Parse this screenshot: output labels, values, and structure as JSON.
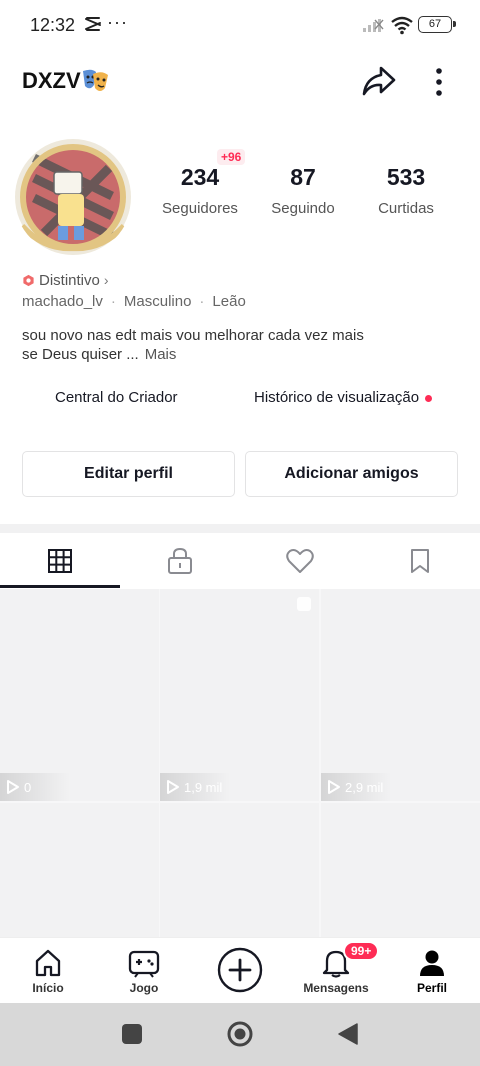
{
  "status_bar": {
    "time": "12:32",
    "dots": "···",
    "battery": "67"
  },
  "header": {
    "username": "DXZV"
  },
  "stats": {
    "followers": {
      "value": "234",
      "label": "Seguidores",
      "new": "+96"
    },
    "following": {
      "value": "87",
      "label": "Seguindo"
    },
    "likes": {
      "value": "533",
      "label": "Curtidas"
    }
  },
  "badge": {
    "label": "Distintivo",
    "chevron": "›"
  },
  "meta": {
    "handle": "machado_lv",
    "gender": "Masculino",
    "sign": "Leão",
    "separator": "·"
  },
  "bio": {
    "line1": "sou novo nas edt mais vou melhorar cada vez mais",
    "line2": "se Deus quiser ...",
    "more": "Mais"
  },
  "links": {
    "creator_center": "Central do Criador",
    "view_history": "Histórico de visualização"
  },
  "buttons": {
    "edit_profile": "Editar perfil",
    "add_friends": "Adicionar amigos"
  },
  "tabs": [
    "videos-grid-icon",
    "private-lock-icon",
    "liked-heart-icon",
    "saved-bookmark-icon"
  ],
  "videos": [
    {
      "views": "0"
    },
    {
      "views": "1,9 mil"
    },
    {
      "views": "2,9 mil"
    },
    {
      "views": ""
    },
    {
      "views": ""
    },
    {
      "views": ""
    }
  ],
  "bottom_nav": {
    "home": "Início",
    "game": "Jogo",
    "messages": "Mensagens",
    "messages_badge": "99+",
    "profile": "Perfil"
  },
  "colors": {
    "accent": "#fe2c55",
    "text": "#161823",
    "divider": "#f1f1f2"
  }
}
